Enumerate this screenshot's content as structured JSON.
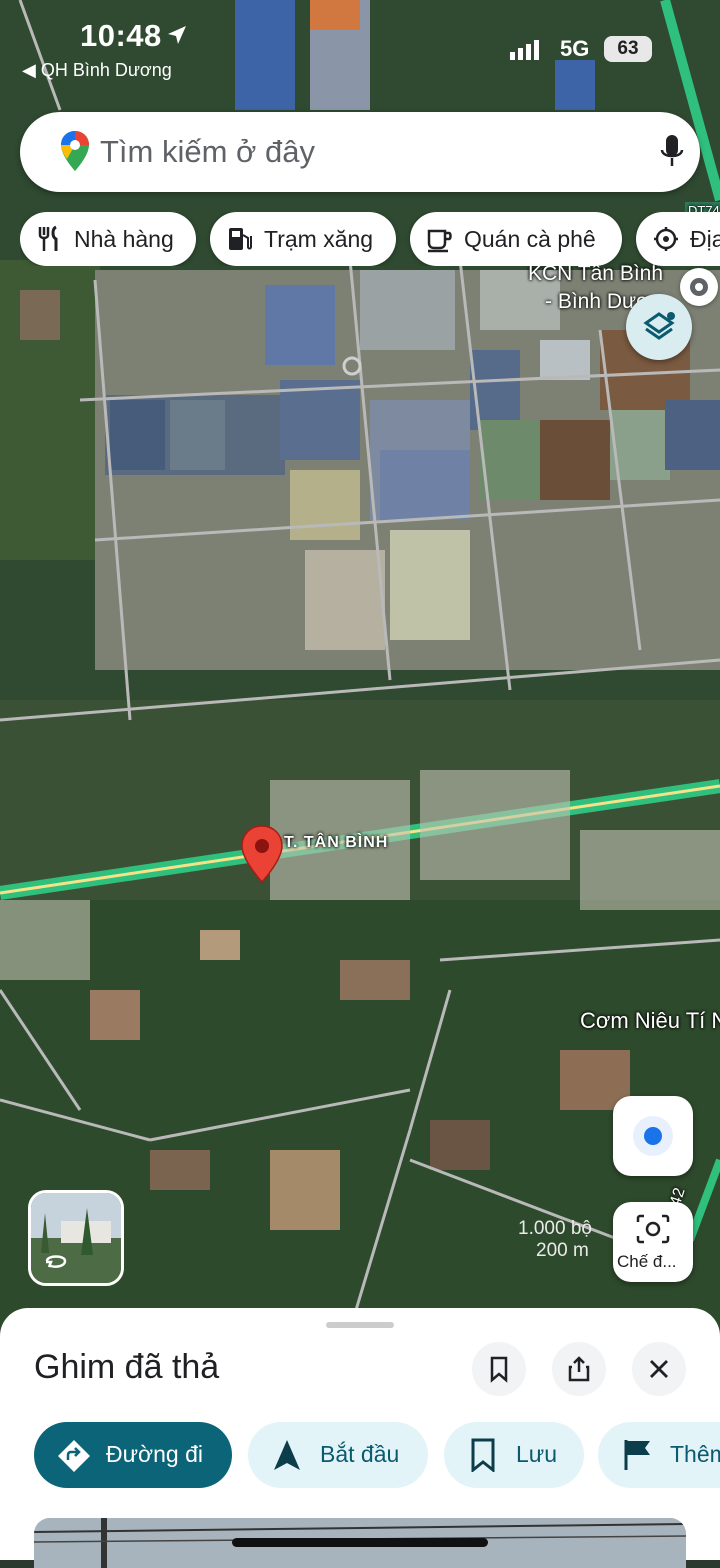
{
  "status_bar": {
    "time": "10:48",
    "back_app": "◀ QH Bình Dương",
    "network": "5G",
    "battery": "63"
  },
  "search": {
    "placeholder": "Tìm kiếm ở đây"
  },
  "chips": [
    {
      "label": "Nhà hàng",
      "icon": "fork-knife-icon"
    },
    {
      "label": "Trạm xăng",
      "icon": "gas-station-icon"
    },
    {
      "label": "Quán cà phê",
      "icon": "coffee-cup-icon"
    },
    {
      "label": "Địa",
      "icon": "landmark-icon"
    }
  ],
  "map": {
    "labels": {
      "industrial_park": "KCN Tân Bình",
      "industrial_park_2": "- Bình Dươ",
      "road": "T. TÂN BÌNH",
      "poi": "Cơm Niêu Tí N",
      "road_side": "Đường 42",
      "route_badge": "DT74"
    },
    "scale": {
      "top": "1.000 bộ",
      "bottom": "200 m"
    },
    "lens_label": "Chế đ...",
    "colors": {
      "route": "#3ee09a",
      "pin": "#d93025",
      "location": "#1a73e8"
    }
  },
  "sheet": {
    "title": "Ghim đã thả",
    "actions": [
      {
        "label": "Đường đi",
        "icon": "directions-icon"
      },
      {
        "label": "Bắt đầu",
        "icon": "navigation-arrow-icon"
      },
      {
        "label": "Lưu",
        "icon": "bookmark-icon"
      },
      {
        "label": "Thêm",
        "icon": "flag-icon"
      }
    ]
  }
}
